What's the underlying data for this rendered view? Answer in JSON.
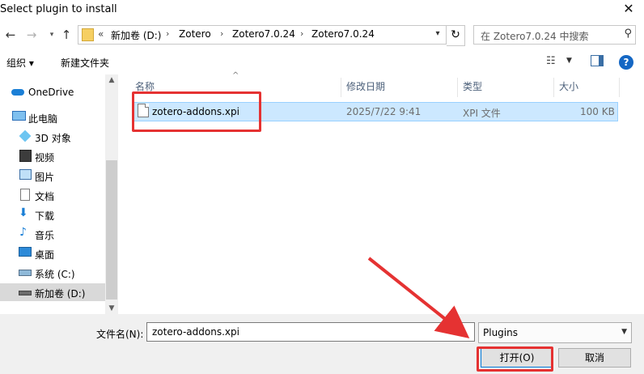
{
  "window": {
    "title": "Select plugin to install"
  },
  "address": {
    "prefix": "«",
    "crumbs": [
      "新加卷 (D:)",
      "Zotero",
      "Zotero7.0.24",
      "Zotero7.0.24"
    ],
    "separator": "›",
    "search_placeholder": "在 Zotero7.0.24 中搜索"
  },
  "toolbar": {
    "organize": "组织 ▾",
    "new_folder": "新建文件夹"
  },
  "nav": {
    "items": [
      "OneDrive",
      "此电脑",
      "3D 对象",
      "视频",
      "图片",
      "文档",
      "下载",
      "音乐",
      "桌面",
      "系统 (C:)",
      "新加卷 (D:)"
    ],
    "selected": "新加卷 (D:)"
  },
  "columns": {
    "name": "名称",
    "modified": "修改日期",
    "type": "类型",
    "size": "大小"
  },
  "files": [
    {
      "name": "zotero-addons.xpi",
      "modified": "2025/7/22 9:41",
      "type": "XPI 文件",
      "size": "100 KB"
    }
  ],
  "bottom": {
    "filename_label": "文件名(N):",
    "filename_value": "zotero-addons.xpi",
    "filter_value": "Plugins",
    "open_label": "打开(O)",
    "cancel_label": "取消"
  },
  "colors": {
    "annotation_red": "#e53232",
    "selection": "#cce8ff",
    "accent": "#0078d7"
  }
}
